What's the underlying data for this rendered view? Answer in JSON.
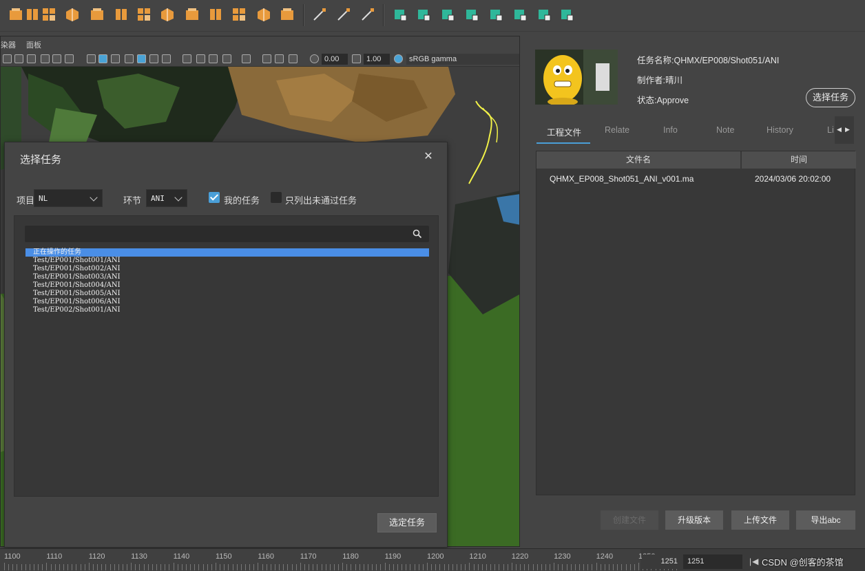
{
  "shelf": {
    "icons": [
      "poly-sphere-icon",
      "poly-cylinder-icon",
      "poly-cube-grid-icon",
      "poly-cubes-icon",
      "poly-cone-icon",
      "poly-plane-icon",
      "poly-box-icon",
      "uv-layout-icon",
      "poly-soccer-icon",
      "extrude-icon",
      "bevel-icon",
      "subdivide-icon",
      "sculpt-icon",
      "draw-curve-icon",
      "lattice-icon",
      "paint-icon",
      "combine-icon",
      "separate-icon",
      "bridge-icon",
      "mirror-icon",
      "bend-icon",
      "checker-icon",
      "symmetry-icon",
      "cut-icon"
    ]
  },
  "viewport": {
    "menu": [
      "染器",
      "面板"
    ],
    "exposure_value": "0.00",
    "gamma_value": "1.00",
    "color_space": "sRGB gamma"
  },
  "dialog": {
    "title": "选择任务",
    "close_glyph": "✕",
    "project_label": "项目",
    "project_value": "NL",
    "step_label": "环节",
    "step_value": "ANI",
    "my_tasks_label": "我的任务",
    "my_tasks_checked": true,
    "unpassed_only_label": "只列出未通过任务",
    "unpassed_only_checked": false,
    "search_placeholder": "",
    "tasks": [
      {
        "label": "正在操作的任务",
        "selected": true
      },
      {
        "label": "Test/EP001/Shot001/ANI",
        "selected": false
      },
      {
        "label": "Test/EP001/Shot002/ANI",
        "selected": false
      },
      {
        "label": "Test/EP001/Shot003/ANI",
        "selected": false
      },
      {
        "label": "Test/EP001/Shot004/ANI",
        "selected": false
      },
      {
        "label": "Test/EP001/Shot005/ANI",
        "selected": false
      },
      {
        "label": "Test/EP001/Shot006/ANI",
        "selected": false
      },
      {
        "label": "Test/EP002/Shot001/ANI",
        "selected": false
      }
    ],
    "confirm_label": "选定任务"
  },
  "task_info": {
    "name": "任务名称:QHMX/EP008/Shot051/ANI",
    "author": "制作者:晴川",
    "status": "状态:Approve",
    "choose_button": "选择任务"
  },
  "tabs": [
    "工程文件",
    "Relate",
    "Info",
    "Note",
    "History",
    "Li"
  ],
  "active_tab": "工程文件",
  "file_table": {
    "columns": [
      "文件名",
      "时间"
    ],
    "rows": [
      {
        "name": "QHMX_EP008_Shot051_ANI_v001.ma",
        "time": "2024/03/06 20:02:00"
      }
    ]
  },
  "actions": {
    "create_file": "创建文件",
    "upgrade_version": "升级版本",
    "upload_file": "上传文件",
    "export_abc": "导出abc"
  },
  "timeline": {
    "ticks": [
      "1100",
      "1110",
      "1120",
      "1130",
      "1140",
      "1150",
      "1160",
      "1170",
      "1180",
      "1190",
      "1200",
      "1210",
      "1220",
      "1230",
      "1240",
      "1250"
    ],
    "current_frame": "1251",
    "end_frame": "1251",
    "watermark": "CSDN @创客的茶馆"
  },
  "colors": {
    "accent": "#4a9fd8",
    "selection": "#4a8ee6",
    "shelf_green": "#2fb79a",
    "shelf_orange": "#e89a3c"
  }
}
